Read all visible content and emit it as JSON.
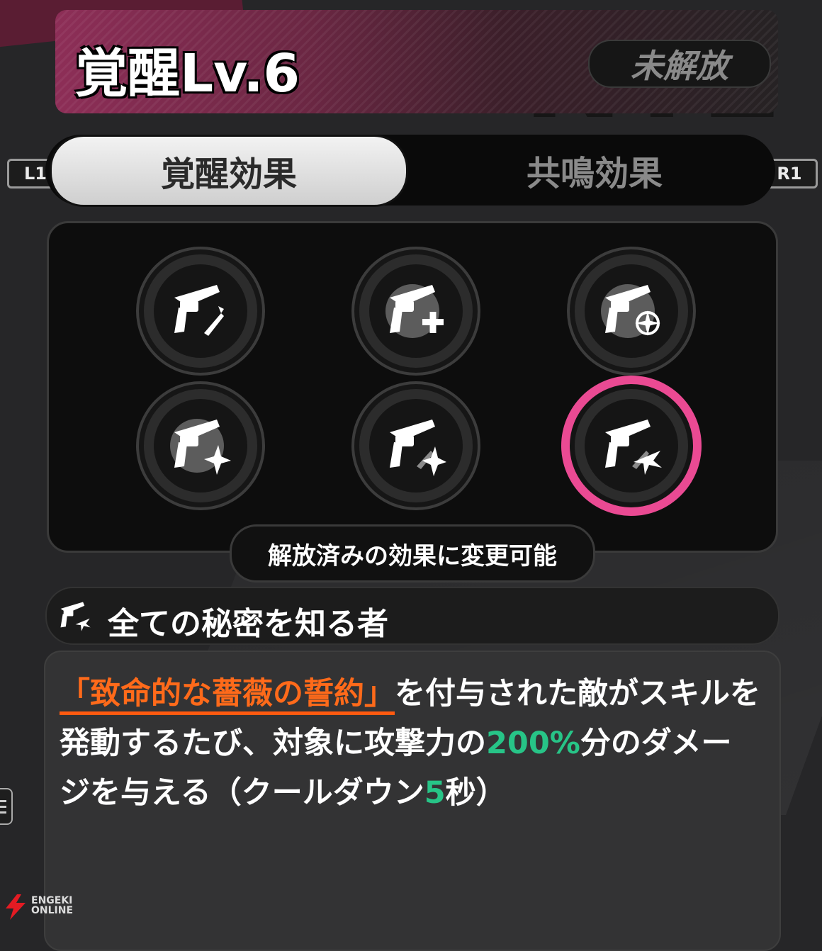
{
  "header": {
    "title": "覚醒Lv.6",
    "status": "未解放"
  },
  "tabs": {
    "left_key": "L1",
    "right_key": "R1",
    "items": [
      {
        "label": "覚醒効果",
        "active": true
      },
      {
        "label": "共鳴効果",
        "active": false
      }
    ]
  },
  "effects": {
    "slots": [
      {
        "icon": "revolver-sword-icon"
      },
      {
        "icon": "revolver-plus-icon"
      },
      {
        "icon": "revolver-compass-icon"
      },
      {
        "icon": "revolver-shuriken-icon"
      },
      {
        "icon": "revolver-star-icon"
      },
      {
        "icon": "revolver-star-burst-icon",
        "selected": true
      }
    ],
    "hint": "解放済みの効果に変更可能"
  },
  "selected_effect": {
    "name": "全ての秘密を知る者",
    "description": {
      "keyword": "「致命的な薔薇の誓約」",
      "text1": "を付与された敵がスキルを発動するたび、対象に攻撃力の",
      "value1": "200%",
      "text2": "分のダメージを与える（クールダウン",
      "value2": "5",
      "text3": "秒）"
    }
  },
  "watermark": {
    "line1": "ENGEKI",
    "line2": "ONLINE"
  },
  "colors": {
    "accent_pink": "#ea4a93",
    "keyword_orange": "#ff6a1a",
    "value_green": "#27c487"
  }
}
